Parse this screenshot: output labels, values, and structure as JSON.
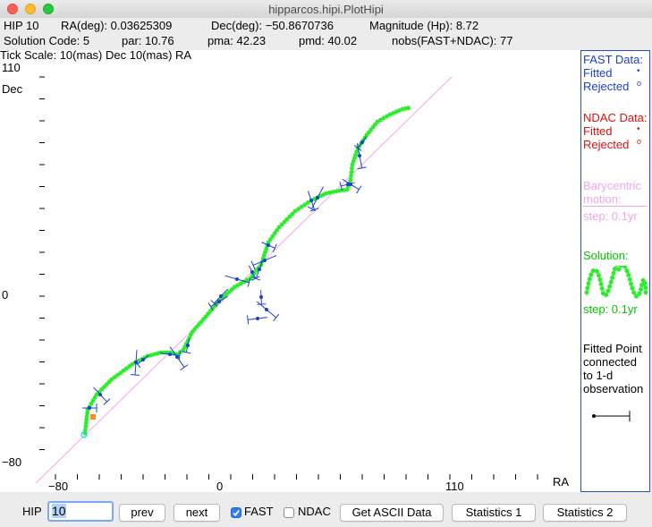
{
  "window": {
    "title": "hipparcos.hipi.PlotHipi"
  },
  "info": {
    "hip": "HIP 10",
    "ra": "RA(deg): 0.03625309",
    "dec": "Dec(deg): −50.8670736",
    "magnitude": "Magnitude (Hp): 8.72",
    "solution_code": "Solution Code: 5",
    "par": "par: 10.76",
    "pma": "pma: 42.23",
    "pmd": "pmd: 40.02",
    "nobs": "nobs(FAST+NDAC): 77",
    "tick_scale": "Tick Scale: 10(mas) Dec 10(mas) RA"
  },
  "plot": {
    "y_top": "110",
    "y_label": "Dec",
    "y_zero": "0",
    "y_bottom": "−80",
    "x_left": "−80",
    "x_zero": "0",
    "x_right": "110",
    "x_label": "RA",
    "colors": {
      "solution": "#2bee2b",
      "fitted": "#1d3fd4",
      "barycentric": "#f2a6ee",
      "start": "#ff8c1a"
    }
  },
  "legend": {
    "fast_title": "FAST Data:",
    "fast_fitted": "Fitted",
    "fast_rejected": "Rejected",
    "ndac_title": "NDAC Data:",
    "ndac_fitted": "Fitted",
    "ndac_rejected": "Rejected",
    "bary_line1": "Barycentric",
    "bary_line2": "motion:",
    "bary_step": "step: 0.1yr",
    "solution_title": "Solution:",
    "solution_step": "step: 0.1yr",
    "fp1": "Fitted Point",
    "fp2": "connected",
    "fp3": "to 1-d",
    "fp4": "observation"
  },
  "controls": {
    "hip_label": "HIP",
    "hip_value": "10",
    "prev": "prev",
    "next": "next",
    "fast_label": "FAST",
    "fast_checked": true,
    "ndac_label": "NDAC",
    "ndac_checked": false,
    "ascii": "Get ASCII Data",
    "stats1": "Statistics 1",
    "stats2": "Statistics 2"
  }
}
